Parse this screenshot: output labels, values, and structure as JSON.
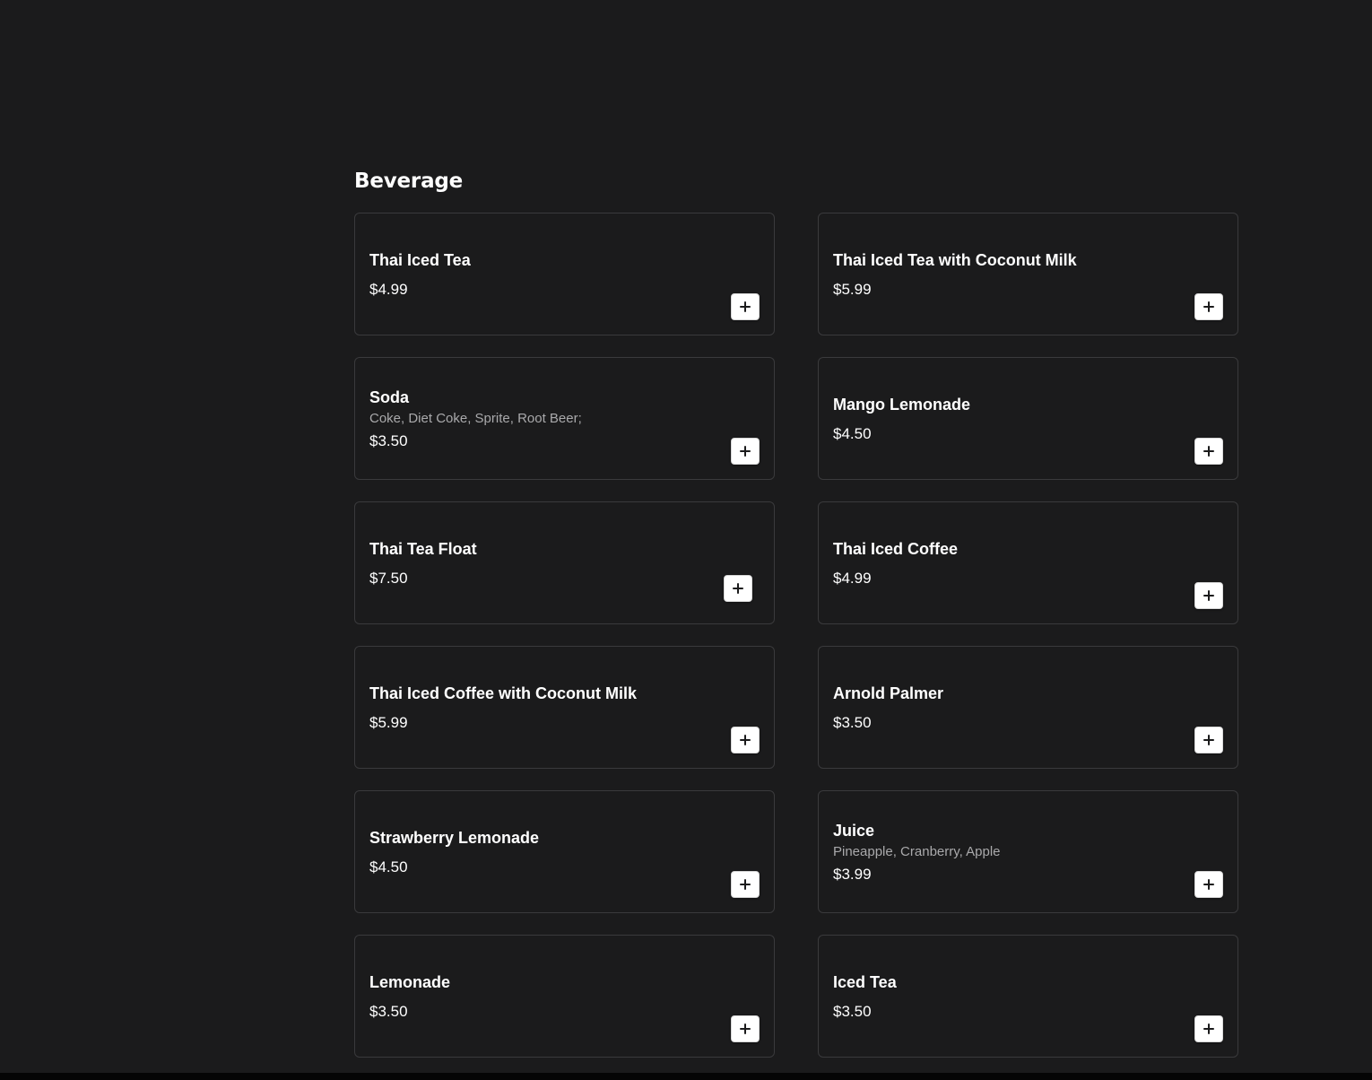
{
  "section": {
    "title": "Beverage"
  },
  "items": [
    {
      "name": "Thai Iced Tea",
      "description": "",
      "price": "$4.99"
    },
    {
      "name": "Thai Iced Tea with Coconut Milk",
      "description": "",
      "price": "$5.99"
    },
    {
      "name": "Soda",
      "description": "Coke, Diet Coke, Sprite, Root Beer;",
      "price": "$3.50"
    },
    {
      "name": "Mango Lemonade",
      "description": "",
      "price": "$4.50"
    },
    {
      "name": "Thai Tea Float",
      "description": "",
      "price": "$7.50"
    },
    {
      "name": "Thai Iced Coffee",
      "description": "",
      "price": "$4.99"
    },
    {
      "name": "Thai Iced Coffee with Coconut Milk",
      "description": "",
      "price": "$5.99"
    },
    {
      "name": "Arnold Palmer",
      "description": "",
      "price": "$3.50"
    },
    {
      "name": "Strawberry Lemonade",
      "description": "",
      "price": "$4.50"
    },
    {
      "name": "Juice",
      "description": "Pineapple, Cranberry, Apple",
      "price": "$3.99"
    },
    {
      "name": "Lemonade",
      "description": "",
      "price": "$3.50"
    },
    {
      "name": "Iced Tea",
      "description": "",
      "price": "$3.50"
    }
  ],
  "icons": {
    "add": "plus-icon"
  },
  "colors": {
    "background": "#1b1b1c",
    "card_border": "#3a3a3c",
    "text": "#ffffff",
    "description": "#a9a9ab",
    "button_bg": "#ffffff"
  }
}
